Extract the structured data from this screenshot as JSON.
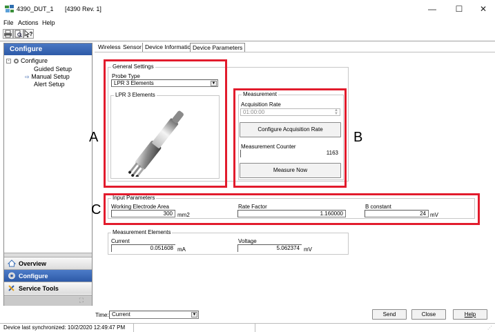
{
  "window": {
    "title": "4390_DUT_1",
    "subtitle": "[4390 Rev. 1]",
    "controls": {
      "minimize": "—",
      "maximize": "☐",
      "close": "✕"
    }
  },
  "menu": [
    "File",
    "Actions",
    "Help"
  ],
  "toolbar": {
    "icons": [
      "printer-icon",
      "print-preview-icon",
      "context-help-icon"
    ]
  },
  "left_pane": {
    "header": "Configure",
    "tree": {
      "root": "Configure",
      "children": [
        "Guided Setup",
        "Manual Setup",
        "Alert Setup"
      ],
      "selected": "Manual Setup"
    },
    "nav_buttons": [
      "Overview",
      "Configure",
      "Service Tools"
    ],
    "active_nav": "Configure"
  },
  "tabs": [
    "Wireless",
    "Sensor",
    "Device Information",
    "Device Parameters"
  ],
  "active_tab": "Sensor",
  "general_settings": {
    "title": "General Settings",
    "probe_type_label": "Probe Type",
    "probe_type_value": "LPR 3 Elements",
    "image_group_title": "LPR 3 Elements"
  },
  "measurement": {
    "title": "Measurement",
    "acquisition_rate_label": "Acquisition Rate",
    "acquisition_rate_value": "01:00:00",
    "configure_button": "Configure Acquisition Rate",
    "counter_label": "Measurement Counter",
    "counter_value": "1163",
    "measure_now_button": "Measure Now"
  },
  "input_parameters": {
    "title": "Input Parameters",
    "working_electrode_area_label": "Working Electrode Area",
    "working_electrode_area_value": "300",
    "working_electrode_area_unit": "mm2",
    "rate_factor_label": "Rate Factor",
    "rate_factor_value": "1.160000",
    "b_constant_label": "B constant",
    "b_constant_value": "24",
    "b_constant_unit": "mV"
  },
  "measurement_elements": {
    "title": "Measurement Elements",
    "current_label": "Current",
    "current_value": "0.051608",
    "current_unit": "mA",
    "voltage_label": "Voltage",
    "voltage_value": "5.062374",
    "voltage_unit": "mV"
  },
  "callouts": [
    "A",
    "B",
    "C"
  ],
  "callout_color": "#e21b2c",
  "bottom": {
    "time_label": "Time:",
    "time_value": "Current",
    "send": "Send",
    "close": "Close",
    "help": "Help"
  },
  "status": "Device last synchronized: 10/2/2020 12:49:47 PM"
}
